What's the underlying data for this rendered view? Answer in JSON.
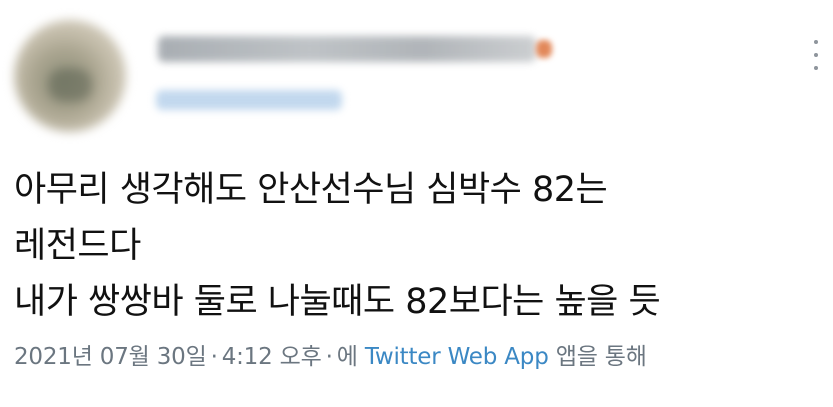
{
  "tweet": {
    "author": {
      "display_name": "",
      "handle": ""
    },
    "more_menu": {
      "icon": "more-vertical-icon"
    },
    "text_lines": [
      "아무리 생각해도 안산선수님 심박수 82는",
      "레전드다",
      "내가 쌍쌍바 둘로 나눌때도 82보다는 높을 듯"
    ],
    "meta": {
      "date": "2021년 07월 30일",
      "separator_1": "·",
      "time": "4:12 오후",
      "separator_2": "·",
      "via_prefix": "에",
      "source": "Twitter Web App",
      "via_suffix": "앱을 통해"
    },
    "colors": {
      "text": "#111111",
      "meta_text": "#6b7680",
      "link": "#3b88c4",
      "background": "#ffffff"
    }
  }
}
